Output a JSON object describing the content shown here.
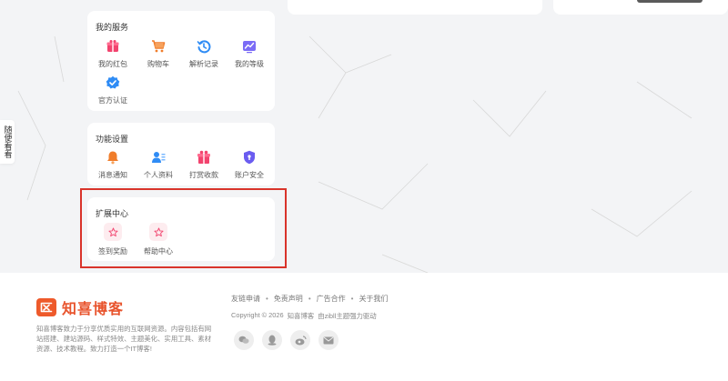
{
  "side_tab": {
    "label": "随便看看"
  },
  "services": {
    "title": "我的服务",
    "items": [
      {
        "label": "我的红包",
        "icon": "red-packet-icon"
      },
      {
        "label": "购物车",
        "icon": "shopping-cart-icon"
      },
      {
        "label": "解析记录",
        "icon": "history-icon"
      },
      {
        "label": "我的等级",
        "icon": "level-chart-icon"
      },
      {
        "label": "官方认证",
        "icon": "verified-badge-icon"
      }
    ]
  },
  "settings": {
    "title": "功能设置",
    "items": [
      {
        "label": "消息通知",
        "icon": "bell-icon"
      },
      {
        "label": "个人资料",
        "icon": "profile-icon"
      },
      {
        "label": "打赏收款",
        "icon": "gift-icon"
      },
      {
        "label": "账户安全",
        "icon": "shield-icon"
      }
    ]
  },
  "extensions": {
    "title": "扩展中心",
    "items": [
      {
        "label": "签到奖励",
        "icon": "star-icon"
      },
      {
        "label": "帮助中心",
        "icon": "star-icon"
      }
    ]
  },
  "footer": {
    "brand": "知喜博客",
    "description": "知喜博客致力于分享优质实用的互联网资源。内容包括有网站搭建、建站源码、样式特效、主题美化、实用工具、素材资源、技术教程。致力打造一个IT博客!",
    "links": [
      "友链申请",
      "免责声明",
      "广告合作",
      "关于我们"
    ],
    "copyright": [
      "Copyright © 2026",
      "知喜博客",
      "由zibll主题强力驱动"
    ],
    "socials": [
      "wechat-icon",
      "qq-icon",
      "weibo-icon",
      "mail-icon"
    ]
  },
  "colors": {
    "brand": "#ee5a2b",
    "highlight": "#d9342b",
    "accent_blue": "#2f8cf5"
  }
}
